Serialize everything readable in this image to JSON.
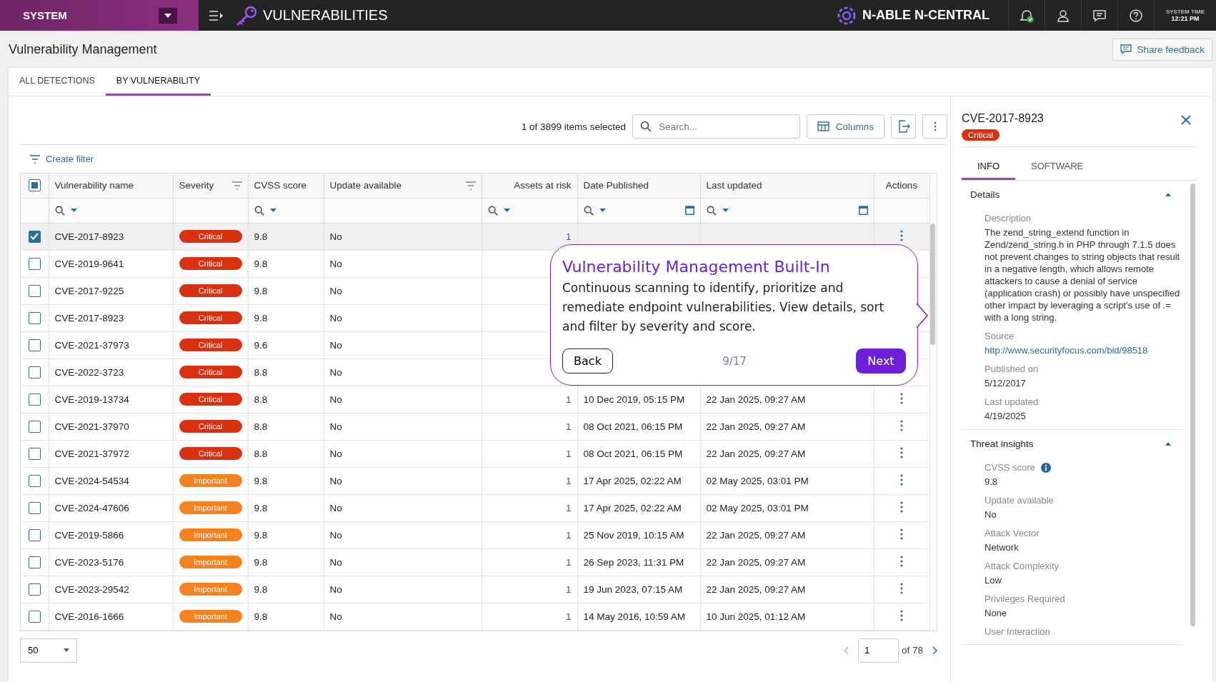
{
  "topbar": {
    "scope": "SYSTEM",
    "module": "VULNERABILITIES",
    "brand": "N-ABLE N-CENTRAL",
    "system_time_label": "SYSTEM TIME",
    "system_time": "12:21 PM"
  },
  "page": {
    "title": "Vulnerability Management",
    "feedback_button": "Share feedback"
  },
  "tabs": [
    {
      "label": "ALL DETECTIONS",
      "selected": false
    },
    {
      "label": "BY VULNERABILITY",
      "selected": true
    }
  ],
  "toolbar": {
    "selection_count": "1 of 3899 items selected",
    "search": {
      "placeholder": "Search..."
    },
    "columns_button": "Columns",
    "create_filter": "Create filter"
  },
  "table": {
    "select_all_partial": true,
    "columns": [
      {
        "label": "Vulnerability name",
        "menu": false,
        "search": true,
        "date_picker": false,
        "numeric": false
      },
      {
        "label": "Severity",
        "menu": true,
        "search": false,
        "date_picker": false,
        "numeric": false
      },
      {
        "label": "CVSS score",
        "menu": false,
        "search": true,
        "date_picker": false,
        "numeric": false
      },
      {
        "label": "Update available",
        "menu": true,
        "search": false,
        "date_picker": false,
        "numeric": false
      },
      {
        "label": "Assets at risk",
        "menu": false,
        "search": true,
        "date_picker": false,
        "numeric": true
      },
      {
        "label": "Date Published",
        "menu": false,
        "search": true,
        "date_picker": true,
        "numeric": false
      },
      {
        "label": "Last updated",
        "menu": false,
        "search": true,
        "date_picker": true,
        "numeric": false
      },
      {
        "label": "Actions",
        "menu": false,
        "search": false,
        "date_picker": false,
        "numeric": false
      }
    ],
    "rows": [
      {
        "name": "CVE-2017-8923",
        "severity": {
          "label": "Critical",
          "color": "#d9300f"
        },
        "cvss": "9.8",
        "update": "No",
        "assets": "1",
        "selected": true
      },
      {
        "name": "CVE-2019-9641",
        "severity": {
          "label": "Critical",
          "color": "#d9300f"
        },
        "cvss": "9.8",
        "update": "No",
        "selected": false
      },
      {
        "name": "CVE-2017-9225",
        "severity": {
          "label": "Critical",
          "color": "#d9300f"
        },
        "cvss": "9.8",
        "update": "No",
        "selected": false
      },
      {
        "name": "CVE-2017-8923",
        "severity": {
          "label": "Critical",
          "color": "#d9300f"
        },
        "cvss": "9.8",
        "update": "No",
        "selected": false
      },
      {
        "name": "CVE-2021-37973",
        "severity": {
          "label": "Critical",
          "color": "#d9300f"
        },
        "cvss": "9.6",
        "update": "No",
        "selected": false
      },
      {
        "name": "CVE-2022-3723",
        "severity": {
          "label": "Critical",
          "color": "#d9300f"
        },
        "cvss": "8.8",
        "update": "No",
        "selected": false
      },
      {
        "name": "CVE-2019-13734",
        "severity": {
          "label": "Critical",
          "color": "#d9300f"
        },
        "cvss": "8.8",
        "update": "No",
        "assets": "1",
        "published": "10 Dec 2019, 05:15 PM",
        "updated": "22 Jan 2025, 09:27 AM",
        "selected": false
      },
      {
        "name": "CVE-2021-37970",
        "severity": {
          "label": "Critical",
          "color": "#d9300f"
        },
        "cvss": "8.8",
        "update": "No",
        "assets": "1",
        "published": "08 Oct 2021, 06:15 PM",
        "updated": "22 Jan 2025, 09:27 AM",
        "selected": false
      },
      {
        "name": "CVE-2021-37972",
        "severity": {
          "label": "Critical",
          "color": "#d9300f"
        },
        "cvss": "8.8",
        "update": "No",
        "assets": "1",
        "published": "08 Oct 2021, 06:15 PM",
        "updated": "22 Jan 2025, 09:27 AM",
        "selected": false
      },
      {
        "name": "CVE-2024-54534",
        "severity": {
          "label": "Important",
          "color": "#f5821f"
        },
        "cvss": "9.8",
        "update": "No",
        "assets": "1",
        "published": "17 Apr 2025, 02:22 AM",
        "updated": "02 May 2025, 03:01 PM",
        "selected": false
      },
      {
        "name": "CVE-2024-47606",
        "severity": {
          "label": "Important",
          "color": "#f5821f"
        },
        "cvss": "9.8",
        "update": "No",
        "assets": "1",
        "published": "17 Apr 2025, 02:22 AM",
        "updated": "02 May 2025, 03:01 PM",
        "selected": false
      },
      {
        "name": "CVE-2019-5866",
        "severity": {
          "label": "Important",
          "color": "#f5821f"
        },
        "cvss": "9.8",
        "update": "No",
        "assets": "1",
        "published": "25 Nov 2019, 10:15 AM",
        "updated": "22 Jan 2025, 09:27 AM",
        "selected": false
      },
      {
        "name": "CVE-2023-5176",
        "severity": {
          "label": "Important",
          "color": "#f5821f"
        },
        "cvss": "9.8",
        "update": "No",
        "assets": "1",
        "published": "26 Sep 2023, 11:31 PM",
        "updated": "22 Jan 2025, 09:27 AM",
        "selected": false
      },
      {
        "name": "CVE-2023-29542",
        "severity": {
          "label": "Important",
          "color": "#f5821f"
        },
        "cvss": "9.8",
        "update": "No",
        "assets": "1",
        "published": "19 Jun 2023, 07:15 AM",
        "updated": "22 Jan 2025, 09:27 AM",
        "selected": false
      },
      {
        "name": "CVE-2016-1666",
        "severity": {
          "label": "Important",
          "color": "#f5821f"
        },
        "cvss": "9.8",
        "update": "No",
        "assets": "1",
        "published": "14 May 2016, 10:59 AM",
        "updated": "10 Jun 2025, 01:12 AM",
        "selected": false
      }
    ]
  },
  "pagination": {
    "page_size": "50",
    "page": "1",
    "of": "of 78"
  },
  "tour": {
    "title": "Vulnerability Management Built-In",
    "body": "Continuous scanning to identify, prioritize and remediate endpoint vulnerabilities. View details, sort and filter by severity and score.",
    "back": "Back",
    "step": "9/17",
    "next": "Next"
  },
  "panel": {
    "title": "CVE-2017-8923",
    "severity": {
      "label": "Critical",
      "color": "#d9300f"
    },
    "tabs": [
      {
        "label": "INFO",
        "selected": true
      },
      {
        "label": "SOFTWARE",
        "selected": false
      }
    ],
    "sections": [
      {
        "title": "Details",
        "expanded": true,
        "fields": [
          {
            "label": "Description",
            "value": "The zend_string_extend function in Zend/zend_string.h in PHP through 7.1.5 does not prevent changes to string objects that result in a negative length, which allows remote attackers to cause a denial of service (application crash) or possibly have unspecified other impact by leveraging a script's use of .= with a long string.",
            "kind": "text"
          },
          {
            "label": "Source",
            "value": "http://www.securityfocus.com/bid/98518",
            "kind": "link"
          },
          {
            "label": "Published on",
            "value": "5/12/2017",
            "kind": "text"
          },
          {
            "label": "Last updated",
            "value": "4/19/2025",
            "kind": "text"
          }
        ]
      },
      {
        "title": "Threat insights",
        "expanded": true,
        "fields": [
          {
            "label": "CVSS score",
            "value": "9.8",
            "kind": "info"
          },
          {
            "label": "Update available",
            "value": "No",
            "kind": "text"
          },
          {
            "label": "Attack Vector",
            "value": "Network",
            "kind": "text"
          },
          {
            "label": "Attack Complexity",
            "value": "Low",
            "kind": "text"
          },
          {
            "label": "Privileges Required",
            "value": "None",
            "kind": "text"
          },
          {
            "label": "User Interaction",
            "kind": "text"
          }
        ]
      }
    ]
  }
}
